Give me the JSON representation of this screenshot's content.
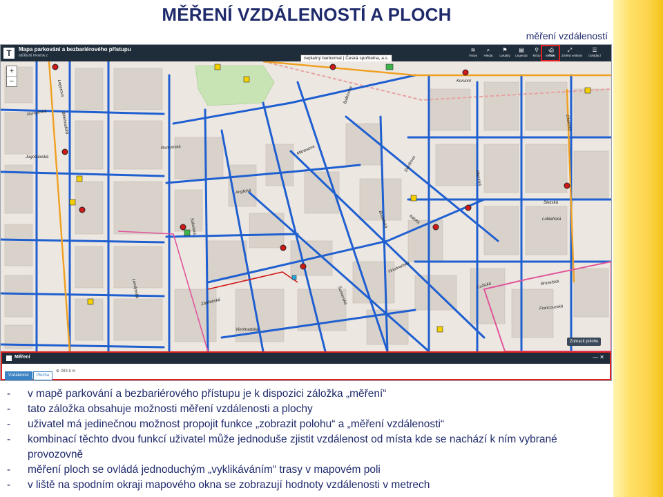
{
  "slide": {
    "title": "MĚŘENÍ VZDÁLENOSTÍ A PLOCH",
    "subtitle": "měření vzdáleností"
  },
  "app": {
    "logo": "T",
    "title": "Mapa parkování a bezbariérového přístupu",
    "subtitle": "MĚŘENÍ PRAHA 2",
    "tooltip": "neplatný bankomat | Česká spořitelna, a.s.",
    "toolbar": [
      {
        "label": "Vrstvy",
        "icon": "layers-icon",
        "glyph": "≋"
      },
      {
        "label": "Hledat",
        "icon": "search-icon",
        "glyph": "⌕"
      },
      {
        "label": "Lokality",
        "icon": "location-icon",
        "glyph": "⚑"
      },
      {
        "label": "Legenda",
        "icon": "legend-icon",
        "glyph": "▤"
      },
      {
        "label": "Místo",
        "icon": "pin-icon",
        "glyph": "⚲"
      },
      {
        "label": "Tisk",
        "icon": "print-icon",
        "glyph": "⎙"
      },
      {
        "label": "Měření",
        "icon": "measure-icon",
        "glyph": "⦦"
      },
      {
        "label": "Změnit velikost",
        "icon": "resize-icon",
        "glyph": "⤢"
      },
      {
        "label": "Ovládací",
        "icon": "controls-icon",
        "glyph": "☰"
      }
    ],
    "zoom": {
      "in": "+",
      "out": "−"
    },
    "streets": [
      "Rumunská",
      "Rumunská",
      "Jugoslávská",
      "Bělehradská",
      "Legerova",
      "Sokolská",
      "Záhřebská",
      "Vinohradská",
      "Korunní",
      "Lublaňská",
      "Balbínova",
      "Slavíkova",
      "Francouzská",
      "Bruselská",
      "Anglická",
      "Mánesova",
      "Italská",
      "Blanická",
      "Chodská",
      "Slezská",
      "Lužická",
      "Budečská",
      "Šumavská",
      "Vinohradská",
      "Londýnská"
    ],
    "show_polygons": "Zobrazit polohu",
    "measure": {
      "title": "Měření",
      "tabs": [
        "Vzdálenost",
        "Plocha"
      ],
      "active_tab": "Vzdálenost",
      "readout": "⊕ 283.8 m",
      "controls": "— ✕"
    }
  },
  "bullets": [
    "v mapě parkování a bezbariérového přístupu je k dispozici záložka „měření“",
    "tato záložka obsahuje možnosti měření vzdálenosti a plochy",
    "uživatel má jedinečnou možnost propojit funkce „zobrazit polohu“ a „měření vzdálenosti“",
    "kombinací těchto dvou funkcí uživatel může jednoduše zjistit vzdálenost od místa kde se nachází k ním vybrané provozovně",
    "měření ploch se ovládá jednoduchým „vyklikáváním“ trasy v mapovém poli",
    "v liště na spodním okraji mapového okna se zobrazují hodnoty vzdálenosti v metrech"
  ],
  "bullet_dash": "-"
}
